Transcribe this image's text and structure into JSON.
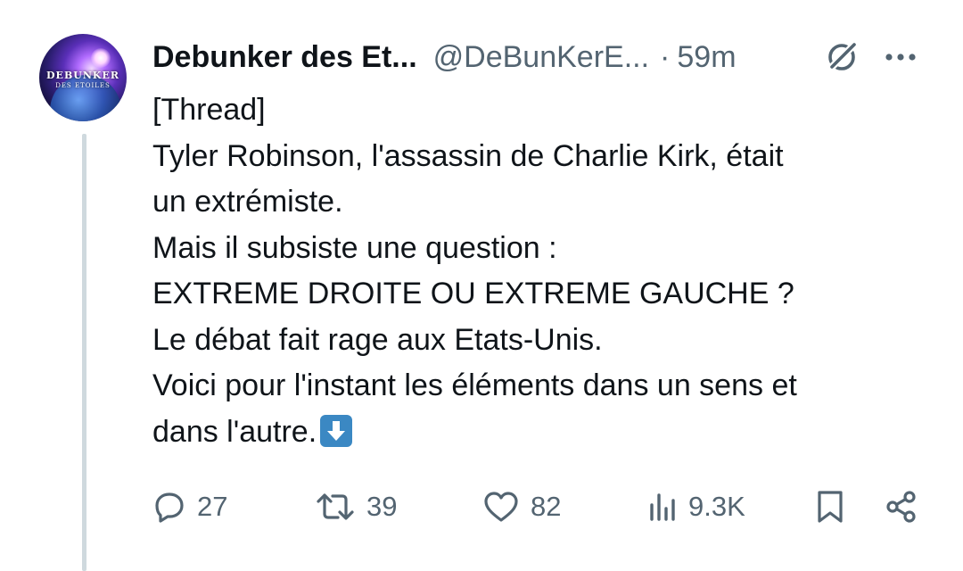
{
  "author": {
    "display_name": "Debunker des Et...",
    "handle": "@DeBunKerE...",
    "separator": "·",
    "time": "59m",
    "avatar_text_line1": "DEBUNKER",
    "avatar_text_line2": "DES ETOILES"
  },
  "tweet": {
    "lines": [
      "[Thread]",
      "Tyler Robinson, l'assassin de Charlie Kirk, était",
      "un extrémiste.",
      "Mais il subsiste une question :",
      "EXTREME DROITE OU EXTREME GAUCHE ?",
      "Le débat fait rage aux Etats-Unis.",
      "Voici pour l'instant les éléments dans un sens et",
      "dans l'autre."
    ],
    "trailing_emoji": "down-arrow-emoji"
  },
  "actions": {
    "replies": "27",
    "retweets": "39",
    "likes": "82",
    "views": "9.3K"
  },
  "icons": {
    "header": [
      "grok-icon",
      "more-icon"
    ],
    "actions": [
      "reply-icon",
      "retweet-icon",
      "like-icon",
      "views-icon",
      "bookmark-icon",
      "share-icon"
    ]
  },
  "colors": {
    "text_primary": "#0f1419",
    "text_secondary": "#536471",
    "thread_line": "#cfd9de",
    "emoji_blue": "#3b88c3"
  }
}
